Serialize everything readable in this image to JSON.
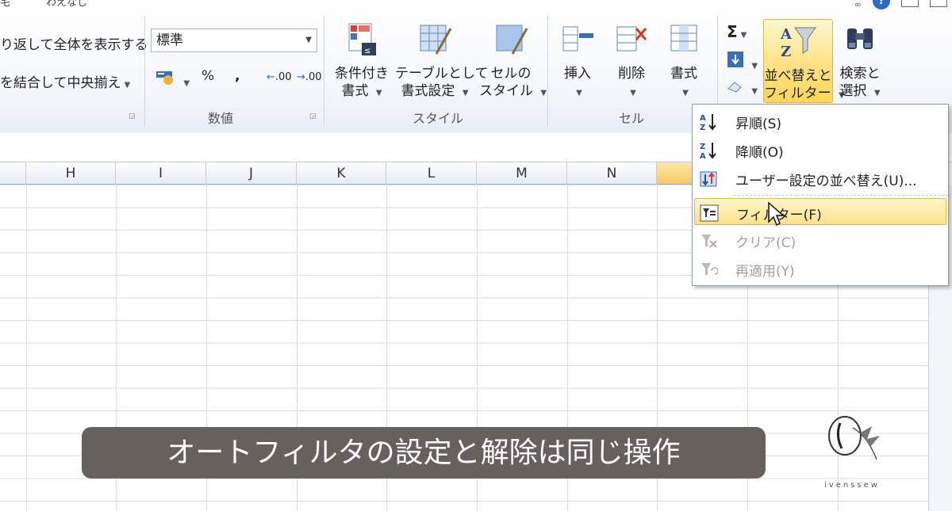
{
  "tabs": [
    "宅",
    "わえなし"
  ],
  "ribbon": {
    "alignment": {
      "wrap_text": "り返して全体を表示する",
      "merge_center": "を結合して中央揃え"
    },
    "number": {
      "format_value": "標準",
      "percent": "%",
      "comma": ",",
      "increase_decimal": ".00",
      "decrease_decimal": ".00",
      "group_label": "数値"
    },
    "styles": {
      "conditional_formatting": [
        "条件付き",
        "書式"
      ],
      "format_as_table": [
        "テーブルとして",
        "書式設定"
      ],
      "cell_styles": [
        "セルの",
        "スタイル"
      ],
      "group_label": "スタイル"
    },
    "cells": {
      "insert": "挿入",
      "delete": "削除",
      "format": "書式",
      "group_label": "セル"
    },
    "editing": {
      "sort_filter": [
        "並べ替えと",
        "フィルター"
      ],
      "find_select": [
        "検索と",
        "選択"
      ]
    }
  },
  "grid": {
    "columns": [
      "H",
      "I",
      "J",
      "K",
      "L",
      "M",
      "N",
      ""
    ]
  },
  "menu": {
    "items": [
      {
        "label": "昇順(S)",
        "icon": "sort-ascending-icon",
        "disabled": false
      },
      {
        "label": "降順(O)",
        "icon": "sort-descending-icon",
        "disabled": false
      },
      {
        "label": "ユーザー設定の並べ替え(U)...",
        "icon": "custom-sort-icon",
        "disabled": false
      },
      {
        "label": "フィルター(F)",
        "icon": "filter-icon",
        "disabled": false,
        "highlighted": true
      },
      {
        "label": "クリア(C)",
        "icon": "clear-filter-icon",
        "disabled": true
      },
      {
        "label": "再適用(Y)",
        "icon": "reapply-filter-icon",
        "disabled": true
      }
    ]
  },
  "caption": "オートフィルタの設定と解除は同じ操作",
  "logo_text": "ivenssew",
  "colors": {
    "highlight": "#ffe28a",
    "selected_column": "#f6c966",
    "caption_bg": "#5a5450"
  }
}
